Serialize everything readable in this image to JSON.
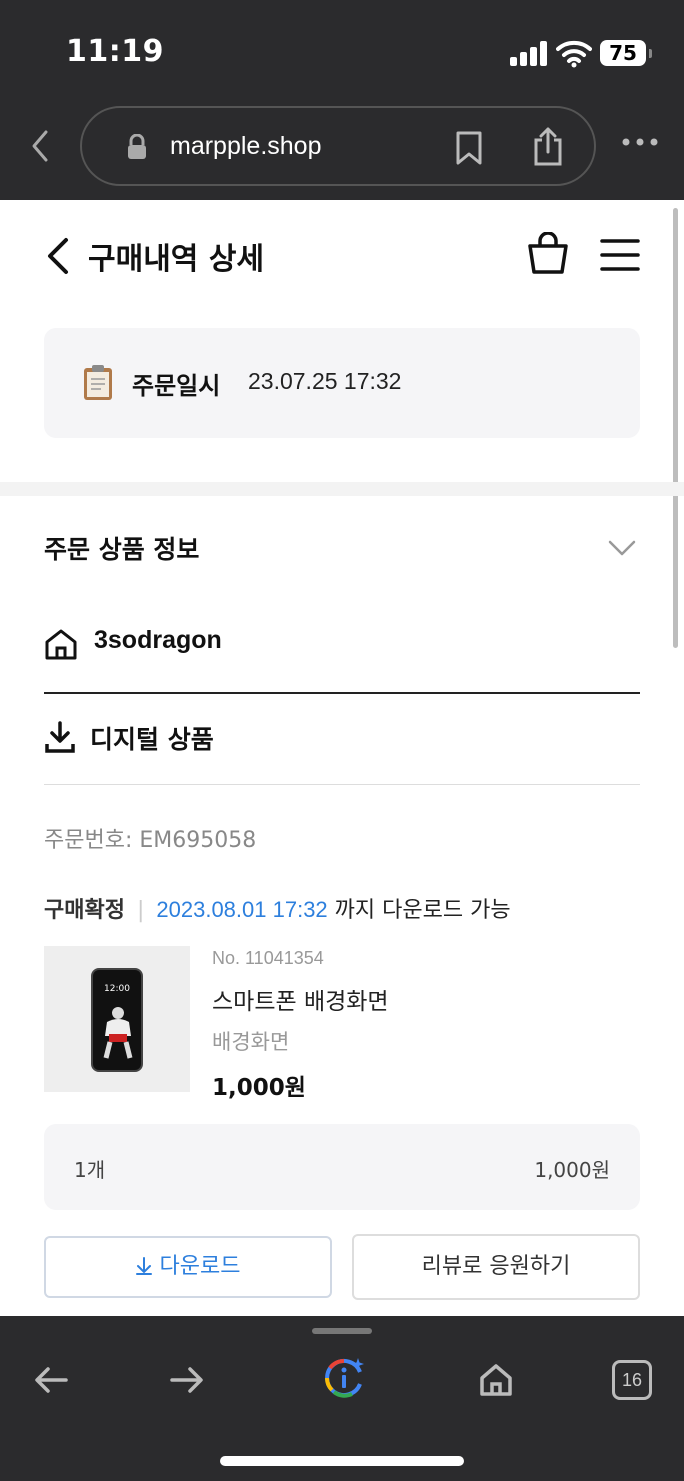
{
  "status_bar": {
    "time": "11:19",
    "battery": "75"
  },
  "browser": {
    "url": "marpple.shop",
    "tab_count": "16"
  },
  "header": {
    "title": "구매내역 상세"
  },
  "order_date": {
    "label": "주문일시",
    "value": "23.07.25 17:32"
  },
  "section": {
    "title": "주문 상품 정보"
  },
  "shop": {
    "name": "3sodragon"
  },
  "product_type": {
    "label": "디지털 상품"
  },
  "order": {
    "number": "주문번호: EM695058",
    "status": "구매확정",
    "download_until": "2023.08.01 17:32",
    "download_suffix": " 까지 다운로드 가능"
  },
  "product": {
    "thumb_time": "12:00",
    "no": "No. 11041354",
    "name": "스마트폰 배경화면",
    "option": "배경화면",
    "price": "1,000원"
  },
  "summary": {
    "quantity": "1개",
    "total": "1,000원"
  },
  "buttons": {
    "download": "다운로드",
    "review": "리뷰로 응원하기"
  },
  "colors": {
    "accent": "#2d7fdd",
    "browser_chrome": "#2b2b2d"
  },
  "icons": [
    "signal-icon",
    "wifi-icon",
    "battery-icon",
    "back-icon",
    "lock-icon",
    "bookmark-icon",
    "share-icon",
    "more-icon",
    "bag-icon",
    "menu-icon",
    "clipboard-icon",
    "chevron-down-icon",
    "home-shop-icon",
    "download-icon",
    "forward-icon",
    "google-icon",
    "home-icon",
    "tabs-icon"
  ]
}
